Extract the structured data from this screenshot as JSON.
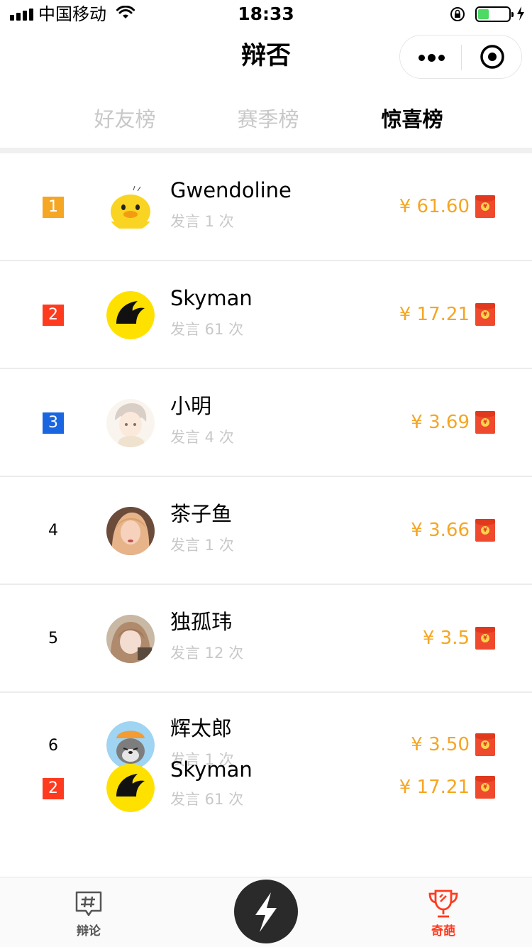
{
  "status_bar": {
    "carrier": "中国移动",
    "time": "18:33",
    "battery_level": 0.35,
    "battery_color": "#4cd964"
  },
  "nav": {
    "title": "辩否",
    "more_icon": "more-dots-icon",
    "close_icon": "target-circle-icon"
  },
  "tabs": [
    {
      "label": "好友榜",
      "active": false
    },
    {
      "label": "赛季榜",
      "active": false
    },
    {
      "label": "惊喜榜",
      "active": true
    }
  ],
  "colors": {
    "rank_1": "#f5a623",
    "rank_2": "#ff3b1f",
    "rank_3": "#1a66e0",
    "amount": "#f5a623",
    "active_tab": "#ff3b1f"
  },
  "leaderboard": [
    {
      "rank": "1",
      "name": "Gwendoline",
      "count": "发言 1 次",
      "amount": "¥ 61.60",
      "avatar": "duck-avatar"
    },
    {
      "rank": "2",
      "name": "Skyman",
      "count": "发言 61 次",
      "amount": "¥ 17.21",
      "avatar": "yellow-bat-avatar"
    },
    {
      "rank": "3",
      "name": "小明",
      "count": "发言 4 次",
      "amount": "¥ 3.69",
      "avatar": "anime-boy-avatar"
    },
    {
      "rank": "4",
      "name": "茶子鱼",
      "count": "发言 1 次",
      "amount": "¥ 3.66",
      "avatar": "photo-avatar"
    },
    {
      "rank": "5",
      "name": "独孤玮",
      "count": "发言 12 次",
      "amount": "¥ 3.5",
      "avatar": "photo-avatar"
    },
    {
      "rank": "6",
      "name": "辉太郎",
      "count": "发言 1 次",
      "amount": "¥ 3.50",
      "avatar": "grey-wolf-avatar"
    },
    {
      "rank": "2",
      "name": "Skyman",
      "count": "发言 61 次",
      "amount": "¥ 17.21",
      "avatar": "yellow-bat-avatar"
    }
  ],
  "bottom_bar": {
    "left": {
      "label": "辩论",
      "icon": "hashtag-chat-icon"
    },
    "center": {
      "icon": "lightning-bolt-icon"
    },
    "right": {
      "label": "奇葩",
      "icon": "trophy-icon",
      "active": true
    }
  }
}
